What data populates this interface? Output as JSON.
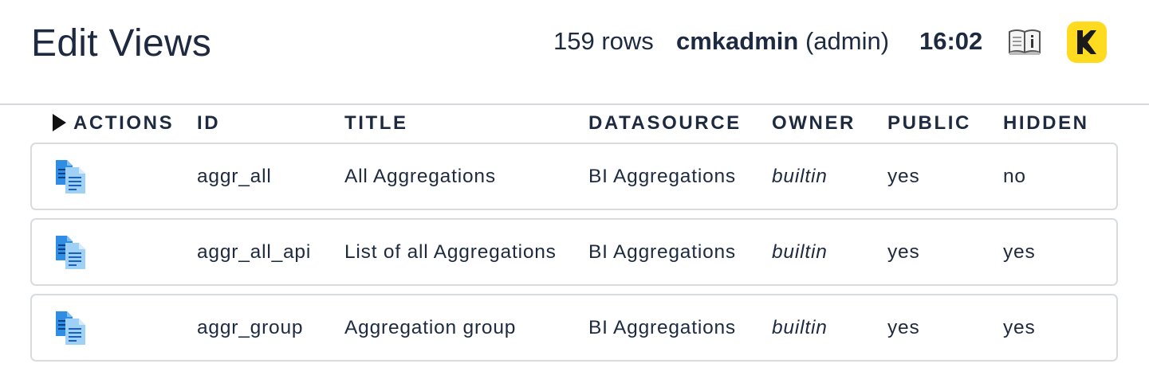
{
  "header": {
    "title": "Edit Views",
    "row_count": "159 rows",
    "user_name": "cmkadmin",
    "user_role": "(admin)",
    "time": "16:02",
    "help_icon": "book-info-icon",
    "logo_icon": "checkmk-logo",
    "logo_color": "#ffdb1f"
  },
  "table": {
    "columns": [
      "ACTIONS",
      "ID",
      "TITLE",
      "DATASOURCE",
      "OWNER",
      "PUBLIC",
      "HIDDEN"
    ],
    "rows": [
      {
        "action_icon": "clone-icon",
        "id": "aggr_all",
        "title": "All Aggregations",
        "datasource": "BI Aggregations",
        "owner": "builtin",
        "public": "yes",
        "hidden": "no"
      },
      {
        "action_icon": "clone-icon",
        "id": "aggr_all_api",
        "title": "List of all Aggregations",
        "datasource": "BI Aggregations",
        "owner": "builtin",
        "public": "yes",
        "hidden": "yes"
      },
      {
        "action_icon": "clone-icon",
        "id": "aggr_group",
        "title": "Aggregation group",
        "datasource": "BI Aggregations",
        "owner": "builtin",
        "public": "yes",
        "hidden": "yes"
      }
    ]
  }
}
